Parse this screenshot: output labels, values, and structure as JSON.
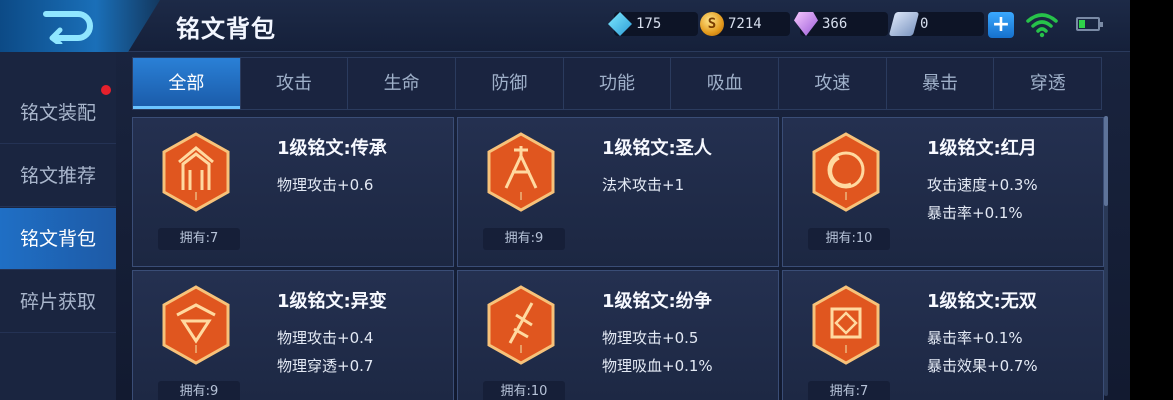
{
  "header": {
    "title": "铭文背包",
    "resources": [
      {
        "name": "diamond",
        "value": "175"
      },
      {
        "name": "gold",
        "icon_letter": "S",
        "value": "7214"
      },
      {
        "name": "gem",
        "value": "366"
      },
      {
        "name": "ticket",
        "value": "0"
      }
    ],
    "add_label": "+"
  },
  "sidebar": {
    "items": [
      {
        "label": "铭文装配"
      },
      {
        "label": "铭文推荐"
      },
      {
        "label": "铭文背包"
      },
      {
        "label": "碎片获取"
      }
    ]
  },
  "tabs": [
    {
      "label": "全部"
    },
    {
      "label": "攻击"
    },
    {
      "label": "生命"
    },
    {
      "label": "防御"
    },
    {
      "label": "功能"
    },
    {
      "label": "吸血"
    },
    {
      "label": "攻速"
    },
    {
      "label": "暴击"
    },
    {
      "label": "穿透"
    }
  ],
  "cards": [
    {
      "title": "1级铭文:传承",
      "stats": [
        "物理攻击+0.6",
        ""
      ],
      "owned": "拥有:7",
      "level": "I"
    },
    {
      "title": "1级铭文:圣人",
      "stats": [
        "法术攻击+1",
        ""
      ],
      "owned": "拥有:9",
      "level": "I"
    },
    {
      "title": "1级铭文:红月",
      "stats": [
        "攻击速度+0.3%",
        "暴击率+0.1%"
      ],
      "owned": "拥有:10",
      "level": "I"
    },
    {
      "title": "1级铭文:异变",
      "stats": [
        "物理攻击+0.4",
        "物理穿透+0.7"
      ],
      "owned": "拥有:9",
      "level": "I"
    },
    {
      "title": "1级铭文:纷争",
      "stats": [
        "物理攻击+0.5",
        "物理吸血+0.1%"
      ],
      "owned": "拥有:10",
      "level": "I"
    },
    {
      "title": "1级铭文:无双",
      "stats": [
        "暴击率+0.1%",
        "暴击效果+0.7%"
      ],
      "owned": "拥有:7",
      "level": "I"
    }
  ],
  "colors": {
    "accent": "#1f6fc5",
    "emblem": "#d2401c",
    "badge": "#e5202c"
  }
}
